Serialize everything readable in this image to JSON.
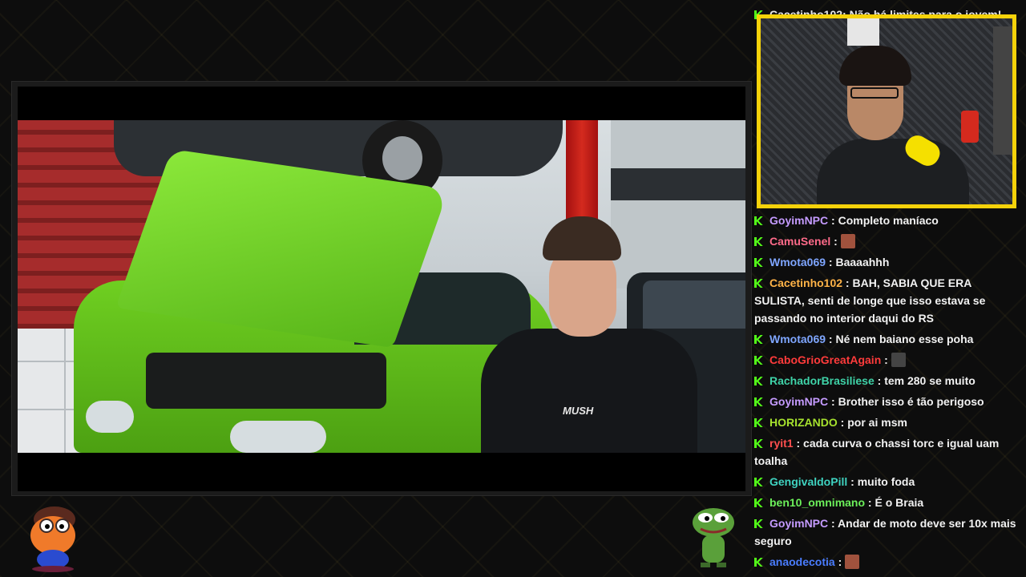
{
  "chat": {
    "top_partial": "Cacetinho102: Não há limites para o jovem!",
    "messages": [
      {
        "user": "GoyimNPC",
        "color": "#c59bff",
        "text": "Completo maníaco",
        "emote": null
      },
      {
        "user": "CamuSenel",
        "color": "#ff6b8a",
        "text": "",
        "emote": "#a0523d"
      },
      {
        "user": "Wmota069",
        "color": "#7fa6ff",
        "text": "Baaaahhh",
        "emote": null
      },
      {
        "user": "Cacetinho102",
        "color": "#ffb347",
        "text": "BAH, SABIA QUE ERA SULISTA, senti de longe que isso estava se passando no interior daqui do RS",
        "emote": null
      },
      {
        "user": "Wmota069",
        "color": "#7fa6ff",
        "text": "Né nem baiano esse poha",
        "emote": null
      },
      {
        "user": "CaboGrioGreatAgain",
        "color": "#ff3b3b",
        "text": "",
        "emote": "#444444"
      },
      {
        "user": "RachadorBrasiliese",
        "color": "#3fd3a8",
        "text": "tem 280 se muito",
        "emote": null
      },
      {
        "user": "GoyimNPC",
        "color": "#c59bff",
        "text": "Brother isso é tão perigoso",
        "emote": null
      },
      {
        "user": "HORIZANDO",
        "color": "#a6e22e",
        "text": "por ai msm",
        "emote": null
      },
      {
        "user": "ryit1",
        "color": "#ff4f4f",
        "text": "cada curva o chassi torc e igual uam toalha",
        "emote": null
      },
      {
        "user": "GengivaldoPill",
        "color": "#3fd3c0",
        "text": "muito foda",
        "emote": null
      },
      {
        "user": "ben10_omnimano",
        "color": "#6cf05a",
        "text": "É o Braia",
        "emote": null
      },
      {
        "user": "GoyimNPC",
        "color": "#c59bff",
        "text": "Andar de moto deve ser 10x mais seguro",
        "emote": null
      },
      {
        "user": "anaodecotia",
        "color": "#4a7dff",
        "text": "",
        "emote": "#a0523d"
      }
    ]
  },
  "video": {
    "shirt_text": "MUSH"
  },
  "colors": {
    "webcam_border": "#f5d20a",
    "badge": "#53fc18"
  }
}
